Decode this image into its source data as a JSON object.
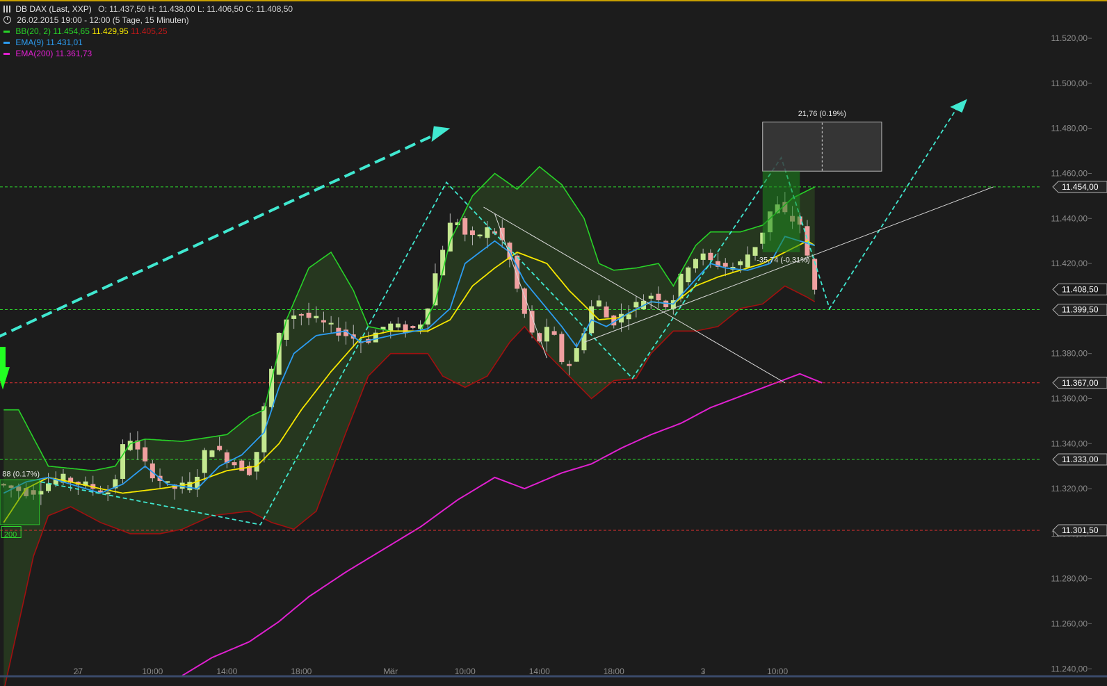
{
  "header": {
    "instrument": "DB DAX (Last, XXP)",
    "ohlc": "O: 11.437,50   H: 11.438,00   L: 11.406,50   C: 11.408,50",
    "period": "26.02.2015 19:00 - 12:00 (5 Tage, 15 Minuten)"
  },
  "legend": {
    "bb": {
      "label": "BB(20, 2)",
      "upper": "11.454,65",
      "middle": "11.429,95",
      "lower": "11.405,25"
    },
    "ema9": {
      "label": "EMA(9)",
      "value": "11.431,01"
    },
    "ema200": {
      "label": "EMA(200)",
      "value": "11.361,73"
    }
  },
  "colors": {
    "background": "#1c1c1c",
    "bb_upper": "#28d228",
    "bb_middle": "#f5e600",
    "bb_lower": "#a01010",
    "ema9": "#2c9cf0",
    "ema200": "#e020d0",
    "bull_candle": "#c4e890",
    "bear_candle": "#f0a0a0",
    "resistance_line": "#2ed82e",
    "support_line": "#e03030",
    "projection": "#40e8d0",
    "trendline": "#d8d8d8"
  },
  "chart_data": {
    "type": "line",
    "title": "DB DAX (Last, XXP)",
    "timeframe": "15 Minuten",
    "ylim": [
      11237,
      11537
    ],
    "y_ticks": [
      {
        "value": 11240,
        "label": "11.240,00"
      },
      {
        "value": 11260,
        "label": "11.260,00"
      },
      {
        "value": 11280,
        "label": "11.280,00"
      },
      {
        "value": 11300,
        "label": "11.300,00"
      },
      {
        "value": 11320,
        "label": "11.320,00"
      },
      {
        "value": 11340,
        "label": "11.340,00"
      },
      {
        "value": 11360,
        "label": "11.360,00"
      },
      {
        "value": 11380,
        "label": "11.380,00"
      },
      {
        "value": 11420,
        "label": "11.420,00"
      },
      {
        "value": 11440,
        "label": "11.440,00"
      },
      {
        "value": 11460,
        "label": "11.460,00"
      },
      {
        "value": 11480,
        "label": "11.480,00"
      },
      {
        "value": 11500,
        "label": "11.500,00"
      },
      {
        "value": 11520,
        "label": "11.520,00"
      }
    ],
    "x_ticks": [
      {
        "bar": 10,
        "label": "27"
      },
      {
        "bar": 20,
        "label": "10:00"
      },
      {
        "bar": 30,
        "label": "14:00"
      },
      {
        "bar": 40,
        "label": "18:00"
      },
      {
        "bar": 52,
        "label": "Mär"
      },
      {
        "bar": 62,
        "label": "10:00"
      },
      {
        "bar": 72,
        "label": "14:00"
      },
      {
        "bar": 82,
        "label": "18:00"
      },
      {
        "bar": 94,
        "label": "3"
      },
      {
        "bar": 104,
        "label": "10:00"
      }
    ],
    "bar_count": 140,
    "price_levels": [
      {
        "value": 11454.0,
        "label": "11.454,00",
        "kind": "resistance"
      },
      {
        "value": 11408.5,
        "label": "11.408,50",
        "kind": "last"
      },
      {
        "value": 11399.5,
        "label": "11.399,50",
        "kind": "resistance"
      },
      {
        "value": 11367.0,
        "label": "11.367,00",
        "kind": "support"
      },
      {
        "value": 11333.0,
        "label": "11.333,00",
        "kind": "resistance"
      },
      {
        "value": 11301.5,
        "label": "11.301,50",
        "kind": "support"
      }
    ],
    "series": [
      {
        "name": "BB(20, 2)",
        "role": "upper",
        "points": [
          [
            0,
            11355
          ],
          [
            2,
            11355
          ],
          [
            6,
            11330
          ],
          [
            12,
            11328
          ],
          [
            15,
            11330
          ],
          [
            17,
            11340
          ],
          [
            19,
            11342
          ],
          [
            24,
            11341
          ],
          [
            30,
            11344
          ],
          [
            33,
            11352
          ],
          [
            35,
            11355
          ],
          [
            38,
            11395
          ],
          [
            41,
            11418
          ],
          [
            44,
            11425
          ],
          [
            47,
            11408
          ],
          [
            49,
            11392
          ],
          [
            52,
            11390
          ],
          [
            56,
            11390
          ],
          [
            58,
            11403
          ],
          [
            60,
            11430
          ],
          [
            63,
            11450
          ],
          [
            66,
            11460
          ],
          [
            69,
            11453
          ],
          [
            72,
            11463
          ],
          [
            75,
            11455
          ],
          [
            78,
            11440
          ],
          [
            80,
            11420
          ],
          [
            82,
            11417
          ],
          [
            85,
            11418
          ],
          [
            88,
            11420
          ],
          [
            90,
            11410
          ],
          [
            93,
            11428
          ],
          [
            95,
            11434
          ],
          [
            99,
            11434
          ],
          [
            102,
            11437
          ],
          [
            106,
            11449
          ],
          [
            109,
            11454
          ]
        ]
      },
      {
        "name": "BB(20, 2)",
        "role": "middle",
        "points": [
          [
            0,
            11305
          ],
          [
            3,
            11320
          ],
          [
            6,
            11325
          ],
          [
            9,
            11323
          ],
          [
            13,
            11320
          ],
          [
            16,
            11318
          ],
          [
            21,
            11320
          ],
          [
            25,
            11322
          ],
          [
            30,
            11328
          ],
          [
            34,
            11330
          ],
          [
            37,
            11340
          ],
          [
            40,
            11355
          ],
          [
            44,
            11372
          ],
          [
            48,
            11387
          ],
          [
            52,
            11390
          ],
          [
            57,
            11390
          ],
          [
            60,
            11395
          ],
          [
            63,
            11410
          ],
          [
            66,
            11418
          ],
          [
            69,
            11425
          ],
          [
            73,
            11420
          ],
          [
            76,
            11408
          ],
          [
            80,
            11395
          ],
          [
            83,
            11396
          ],
          [
            87,
            11403
          ],
          [
            90,
            11402
          ],
          [
            93,
            11410
          ],
          [
            96,
            11414
          ],
          [
            99,
            11417
          ],
          [
            102,
            11420
          ],
          [
            105,
            11425
          ],
          [
            108,
            11430
          ],
          [
            109,
            11428
          ]
        ]
      },
      {
        "name": "BB(20, 2)",
        "role": "lower",
        "points": [
          [
            0,
            11230
          ],
          [
            2,
            11260
          ],
          [
            4,
            11290
          ],
          [
            6,
            11308
          ],
          [
            9,
            11312
          ],
          [
            13,
            11305
          ],
          [
            17,
            11300
          ],
          [
            21,
            11300
          ],
          [
            24,
            11302
          ],
          [
            28,
            11308
          ],
          [
            33,
            11310
          ],
          [
            36,
            11305
          ],
          [
            39,
            11302
          ],
          [
            42,
            11310
          ],
          [
            46,
            11345
          ],
          [
            49,
            11370
          ],
          [
            52,
            11380
          ],
          [
            57,
            11380
          ],
          [
            59,
            11370
          ],
          [
            62,
            11365
          ],
          [
            65,
            11370
          ],
          [
            68,
            11385
          ],
          [
            70,
            11392
          ],
          [
            73,
            11380
          ],
          [
            76,
            11370
          ],
          [
            79,
            11360
          ],
          [
            82,
            11368
          ],
          [
            85,
            11369
          ],
          [
            87,
            11380
          ],
          [
            90,
            11390
          ],
          [
            93,
            11390
          ],
          [
            96,
            11392
          ],
          [
            99,
            11400
          ],
          [
            102,
            11402
          ],
          [
            105,
            11410
          ],
          [
            108,
            11405
          ],
          [
            109,
            11403
          ]
        ]
      },
      {
        "name": "EMA(9)",
        "role": "ema9",
        "points": [
          [
            0,
            11318
          ],
          [
            3,
            11323
          ],
          [
            6,
            11325
          ],
          [
            9,
            11322
          ],
          [
            13,
            11318
          ],
          [
            16,
            11322
          ],
          [
            19,
            11330
          ],
          [
            22,
            11322
          ],
          [
            26,
            11320
          ],
          [
            29,
            11330
          ],
          [
            32,
            11335
          ],
          [
            35,
            11345
          ],
          [
            37,
            11365
          ],
          [
            39,
            11380
          ],
          [
            42,
            11388
          ],
          [
            46,
            11390
          ],
          [
            48,
            11385
          ],
          [
            52,
            11388
          ],
          [
            57,
            11391
          ],
          [
            60,
            11400
          ],
          [
            62,
            11420
          ],
          [
            64,
            11425
          ],
          [
            66,
            11430
          ],
          [
            68,
            11425
          ],
          [
            70,
            11412
          ],
          [
            73,
            11400
          ],
          [
            75,
            11392
          ],
          [
            77,
            11383
          ],
          [
            79,
            11395
          ],
          [
            81,
            11392
          ],
          [
            84,
            11398
          ],
          [
            87,
            11403
          ],
          [
            90,
            11402
          ],
          [
            93,
            11413
          ],
          [
            95,
            11420
          ],
          [
            97,
            11418
          ],
          [
            100,
            11417
          ],
          [
            103,
            11420
          ],
          [
            105,
            11432
          ],
          [
            107,
            11430
          ],
          [
            109,
            11428
          ]
        ]
      },
      {
        "name": "EMA(200)",
        "role": "ema200",
        "points": [
          [
            24,
            11237
          ],
          [
            28,
            11245
          ],
          [
            33,
            11252
          ],
          [
            37,
            11261
          ],
          [
            41,
            11272
          ],
          [
            46,
            11283
          ],
          [
            51,
            11293
          ],
          [
            56,
            11303
          ],
          [
            61,
            11315
          ],
          [
            66,
            11325
          ],
          [
            70,
            11320
          ],
          [
            75,
            11327
          ],
          [
            79,
            11331
          ],
          [
            83,
            11338
          ],
          [
            87,
            11344
          ],
          [
            91,
            11349
          ],
          [
            95,
            11356
          ],
          [
            99,
            11361
          ],
          [
            103,
            11366
          ],
          [
            107,
            11371
          ],
          [
            110,
            11367
          ]
        ]
      }
    ],
    "ohlc_anchors": [
      [
        0,
        11322
      ],
      [
        4,
        11318
      ],
      [
        8,
        11325
      ],
      [
        12,
        11321
      ],
      [
        15,
        11318
      ],
      [
        17,
        11345
      ],
      [
        20,
        11328
      ],
      [
        23,
        11320
      ],
      [
        26,
        11322
      ],
      [
        28,
        11340
      ],
      [
        31,
        11332
      ],
      [
        34,
        11327
      ],
      [
        36,
        11365
      ],
      [
        38,
        11395
      ],
      [
        40,
        11398
      ],
      [
        43,
        11394
      ],
      [
        46,
        11389
      ],
      [
        49,
        11385
      ],
      [
        52,
        11393
      ],
      [
        55,
        11390
      ],
      [
        57,
        11395
      ],
      [
        59,
        11422
      ],
      [
        61,
        11442
      ],
      [
        63,
        11430
      ],
      [
        66,
        11436
      ],
      [
        68,
        11428
      ],
      [
        70,
        11402
      ],
      [
        72,
        11384
      ],
      [
        74,
        11392
      ],
      [
        76,
        11372
      ],
      [
        78,
        11385
      ],
      [
        80,
        11406
      ],
      [
        82,
        11393
      ],
      [
        84,
        11398
      ],
      [
        86,
        11403
      ],
      [
        88,
        11407
      ],
      [
        90,
        11400
      ],
      [
        92,
        11418
      ],
      [
        94,
        11424
      ],
      [
        96,
        11420
      ],
      [
        99,
        11418
      ],
      [
        102,
        11430
      ],
      [
        104,
        11447
      ],
      [
        106,
        11440
      ],
      [
        108,
        11437
      ],
      [
        109,
        11408
      ]
    ],
    "annotations": [
      {
        "text": "21,76 (0.19%)"
      },
      {
        "text": "-35,74 (-0.31%)"
      },
      {
        "text": "88 (0.17%)"
      },
      {
        "text": "200"
      }
    ]
  }
}
